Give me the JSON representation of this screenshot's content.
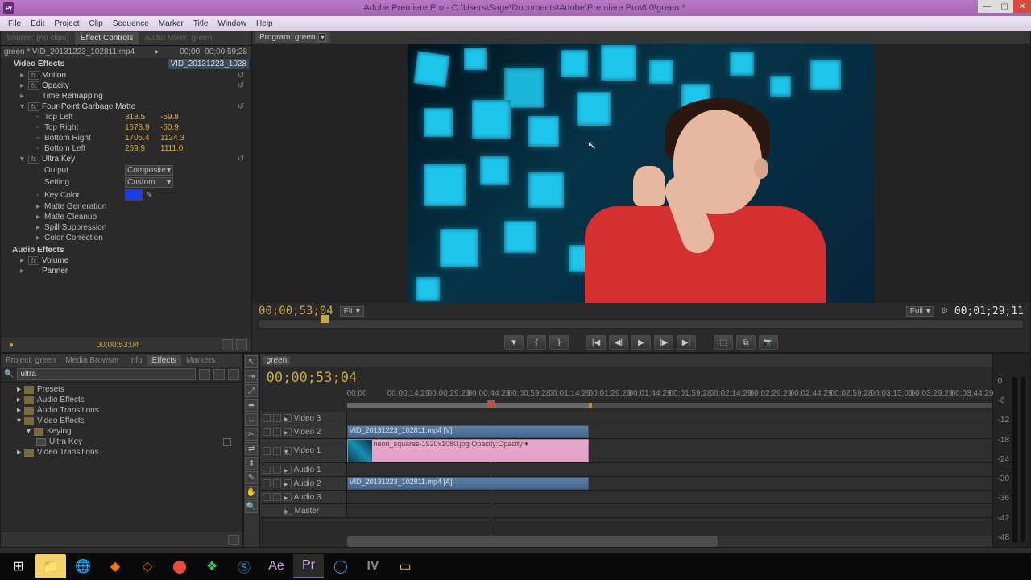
{
  "window": {
    "title": "Adobe Premiere Pro - C:\\Users\\Sage\\Documents\\Adobe\\Premiere Pro\\6.0\\green *",
    "icon_text": "Pr"
  },
  "menubar": [
    "File",
    "Edit",
    "Project",
    "Clip",
    "Sequence",
    "Marker",
    "Title",
    "Window",
    "Help"
  ],
  "effect_controls": {
    "tabs": [
      "Source: (no clips)",
      "Effect Controls",
      "Audio Mixer: green"
    ],
    "clip_path": "green * VID_20131223_102811.mp4",
    "tc_left": "00;00",
    "tc_right": "00;00;59;28",
    "highlight_clip": "VID_20131223_1028",
    "video_effects_header": "Video Effects",
    "effects": {
      "motion": "Motion",
      "opacity": "Opacity",
      "time_remap": "Time Remapping",
      "garbage": "Four-Point Garbage Matte",
      "garbage_params": [
        {
          "label": "Top Left",
          "x": "318.5",
          "y": "-59.8"
        },
        {
          "label": "Top Right",
          "x": "1678.9",
          "y": "-50.9"
        },
        {
          "label": "Bottom Right",
          "x": "1705.4",
          "y": "1124.3"
        },
        {
          "label": "Bottom Left",
          "x": "269.9",
          "y": "1111.0"
        }
      ],
      "ultra": "Ultra Key",
      "ultra_params": {
        "output": {
          "label": "Output",
          "value": "Composite"
        },
        "setting": {
          "label": "Setting",
          "value": "Custom"
        },
        "key_color": "Key Color",
        "matte_gen": "Matte Generation",
        "matte_cleanup": "Matte Cleanup",
        "spill": "Spill Suppression",
        "color_corr": "Color Correction"
      }
    },
    "audio_effects_header": "Audio Effects",
    "audio_effects": {
      "volume": "Volume",
      "panner": "Panner"
    },
    "footer_tc": "00;00;53;04"
  },
  "program": {
    "tab_label": "Program: green",
    "tc": "00;00;53;04",
    "fit": "Fit",
    "full": "Full",
    "duration": "00;01;29;11"
  },
  "effects_panel": {
    "tabs": [
      "Project: green",
      "Media Browser",
      "Info",
      "Effects",
      "Markers"
    ],
    "search": "ultra",
    "tree": [
      {
        "label": "Presets",
        "depth": 0
      },
      {
        "label": "Audio Effects",
        "depth": 0
      },
      {
        "label": "Audio Transitions",
        "depth": 0
      },
      {
        "label": "Video Effects",
        "depth": 0,
        "open": true
      },
      {
        "label": "Keying",
        "depth": 1,
        "open": true
      },
      {
        "label": "Ultra Key",
        "depth": 2,
        "fx": true
      },
      {
        "label": "Video Transitions",
        "depth": 0
      }
    ]
  },
  "timeline": {
    "tab": "green",
    "tc": "00;00;53;04",
    "ruler": [
      "00;00",
      "00;00;14;29",
      "00;00;29;29",
      "00;00;44;29",
      "00;00;59;28",
      "00;01;14;29",
      "00;01;29;29",
      "00;01;44;29",
      "00;01;59;28",
      "00;02;14;29",
      "00;02;29;29",
      "00;02;44;29",
      "00;02;59;28",
      "00;03;15;00",
      "00;03;29;29",
      "00;03;44;29"
    ],
    "tracks": {
      "v3": "Video 3",
      "v2": "Video 2",
      "v2_clip": "VID_20131223_102811.mp4 [V]",
      "v1": "Video 1",
      "v1_clip": "neon_squares-1920x1080.jpg  Opacity:Opacity ▾",
      "a1": "Audio 1",
      "a2": "Audio 2",
      "a2_clip": "VID_20131223_102811.mp4 [A]",
      "a3": "Audio 3",
      "master": "Master"
    }
  },
  "taskbar": {
    "icons": [
      "start",
      "explorer",
      "chrome",
      "blender",
      "inkscape",
      "screenrec",
      "leaf",
      "skype",
      "ae",
      "pr",
      "vc",
      "iv",
      "note"
    ]
  }
}
